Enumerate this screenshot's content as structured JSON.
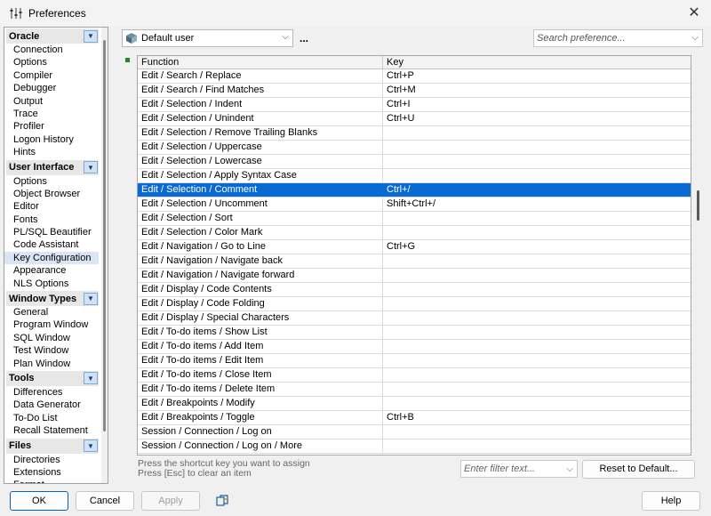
{
  "window": {
    "title": "Preferences"
  },
  "sidebar": {
    "sections": [
      {
        "label": "Oracle",
        "items": [
          "Connection",
          "Options",
          "Compiler",
          "Debugger",
          "Output",
          "Trace",
          "Profiler",
          "Logon History",
          "Hints"
        ]
      },
      {
        "label": "User Interface",
        "items": [
          "Options",
          "Object Browser",
          "Editor",
          "Fonts",
          "PL/SQL Beautifier",
          "Code Assistant",
          "Key Configuration",
          "Appearance",
          "NLS Options"
        ]
      },
      {
        "label": "Window Types",
        "items": [
          "General",
          "Program Window",
          "SQL Window",
          "Test Window",
          "Plan Window"
        ]
      },
      {
        "label": "Tools",
        "items": [
          "Differences",
          "Data Generator",
          "To-Do List",
          "Recall Statement"
        ]
      },
      {
        "label": "Files",
        "items": [
          "Directories",
          "Extensions",
          "Format"
        ]
      }
    ],
    "selected": "Key Configuration"
  },
  "toolbar": {
    "user_select_value": "Default user",
    "more_label": "...",
    "search_placeholder": "Search preference..."
  },
  "grid": {
    "columns": [
      "Function",
      "Key"
    ],
    "rows": [
      [
        "Edit / Search / Replace",
        "Ctrl+P"
      ],
      [
        "Edit / Search / Find Matches",
        "Ctrl+M"
      ],
      [
        "Edit / Selection / Indent",
        "Ctrl+I"
      ],
      [
        "Edit / Selection / Unindent",
        "Ctrl+U"
      ],
      [
        "Edit / Selection / Remove Trailing Blanks",
        ""
      ],
      [
        "Edit / Selection / Uppercase",
        ""
      ],
      [
        "Edit / Selection / Lowercase",
        ""
      ],
      [
        "Edit / Selection / Apply Syntax Case",
        ""
      ],
      [
        "Edit / Selection / Comment",
        "Ctrl+/"
      ],
      [
        "Edit / Selection / Uncomment",
        "Shift+Ctrl+/"
      ],
      [
        "Edit / Selection / Sort",
        ""
      ],
      [
        "Edit / Selection / Color Mark",
        ""
      ],
      [
        "Edit / Navigation / Go to Line",
        "Ctrl+G"
      ],
      [
        "Edit / Navigation / Navigate back",
        ""
      ],
      [
        "Edit / Navigation / Navigate forward",
        ""
      ],
      [
        "Edit / Display / Code Contents",
        ""
      ],
      [
        "Edit / Display / Code Folding",
        ""
      ],
      [
        "Edit / Display / Special Characters",
        ""
      ],
      [
        "Edit / To-do items / Show List",
        ""
      ],
      [
        "Edit / To-do items / Add Item",
        ""
      ],
      [
        "Edit / To-do items / Edit Item",
        ""
      ],
      [
        "Edit / To-do items / Close Item",
        ""
      ],
      [
        "Edit / To-do items / Delete Item",
        ""
      ],
      [
        "Edit / Breakpoints / Modify",
        ""
      ],
      [
        "Edit / Breakpoints / Toggle",
        "Ctrl+B"
      ],
      [
        "Session / Connection / Log on",
        ""
      ],
      [
        "Session / Connection / Log on / More",
        ""
      ]
    ],
    "selected_index": 8
  },
  "hint": {
    "line1": "Press the shortcut key you want to assign",
    "line2": "Press [Esc] to clear an item"
  },
  "filter": {
    "placeholder": "Enter filter text..."
  },
  "buttons": {
    "reset": "Reset to Default...",
    "ok": "OK",
    "cancel": "Cancel",
    "apply": "Apply",
    "help": "Help"
  },
  "colors": {
    "selection": "#0a6ad3",
    "nav_selected": "#dbe6f4",
    "indicator": "#1d8a1d"
  }
}
